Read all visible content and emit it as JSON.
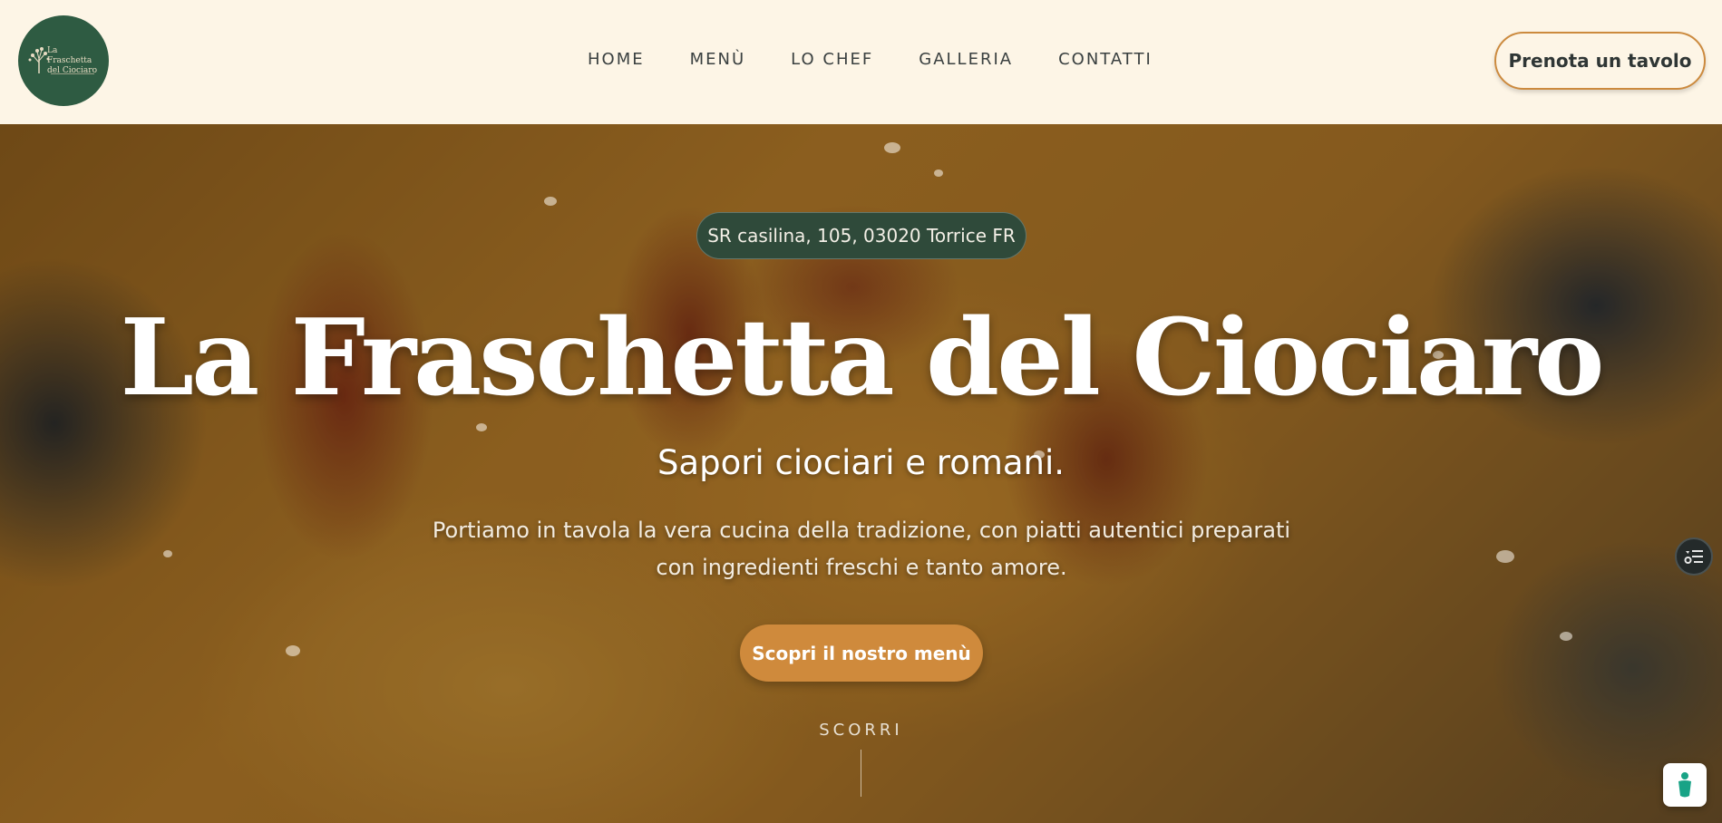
{
  "header": {
    "logo": {
      "text_line1": "La Fraschetta",
      "text_line2": "del Ciociaro",
      "icon": "olive-tree-icon"
    },
    "nav": {
      "items": [
        {
          "label": "HOME"
        },
        {
          "label": "MENÙ"
        },
        {
          "label": "LO CHEF"
        },
        {
          "label": "GALLERIA"
        },
        {
          "label": "CONTATTI"
        }
      ]
    },
    "reserve_label": "Prenota un tavolo"
  },
  "hero": {
    "address": "SR casilina, 105, 03020 Torrice FR",
    "title": "La Fraschetta del Ciociaro",
    "subtitle": "Sapori ciociari e romani.",
    "description": "Portiamo in tavola la vera cucina della tradizione, con piatti autentici preparati con ingredienti freschi e tanto amore.",
    "cta_label": "Scopri il nostro menù",
    "scroll_label": "SCORRI"
  },
  "widgets": {
    "filter_icon": "filter-settings-icon",
    "chat_icon": "accessibility-person-icon"
  },
  "colors": {
    "header_bg": "#fdf5e6",
    "accent_orange": "#cf8a3c",
    "brand_green": "#2e5b42",
    "nav_text": "#3a4040"
  }
}
